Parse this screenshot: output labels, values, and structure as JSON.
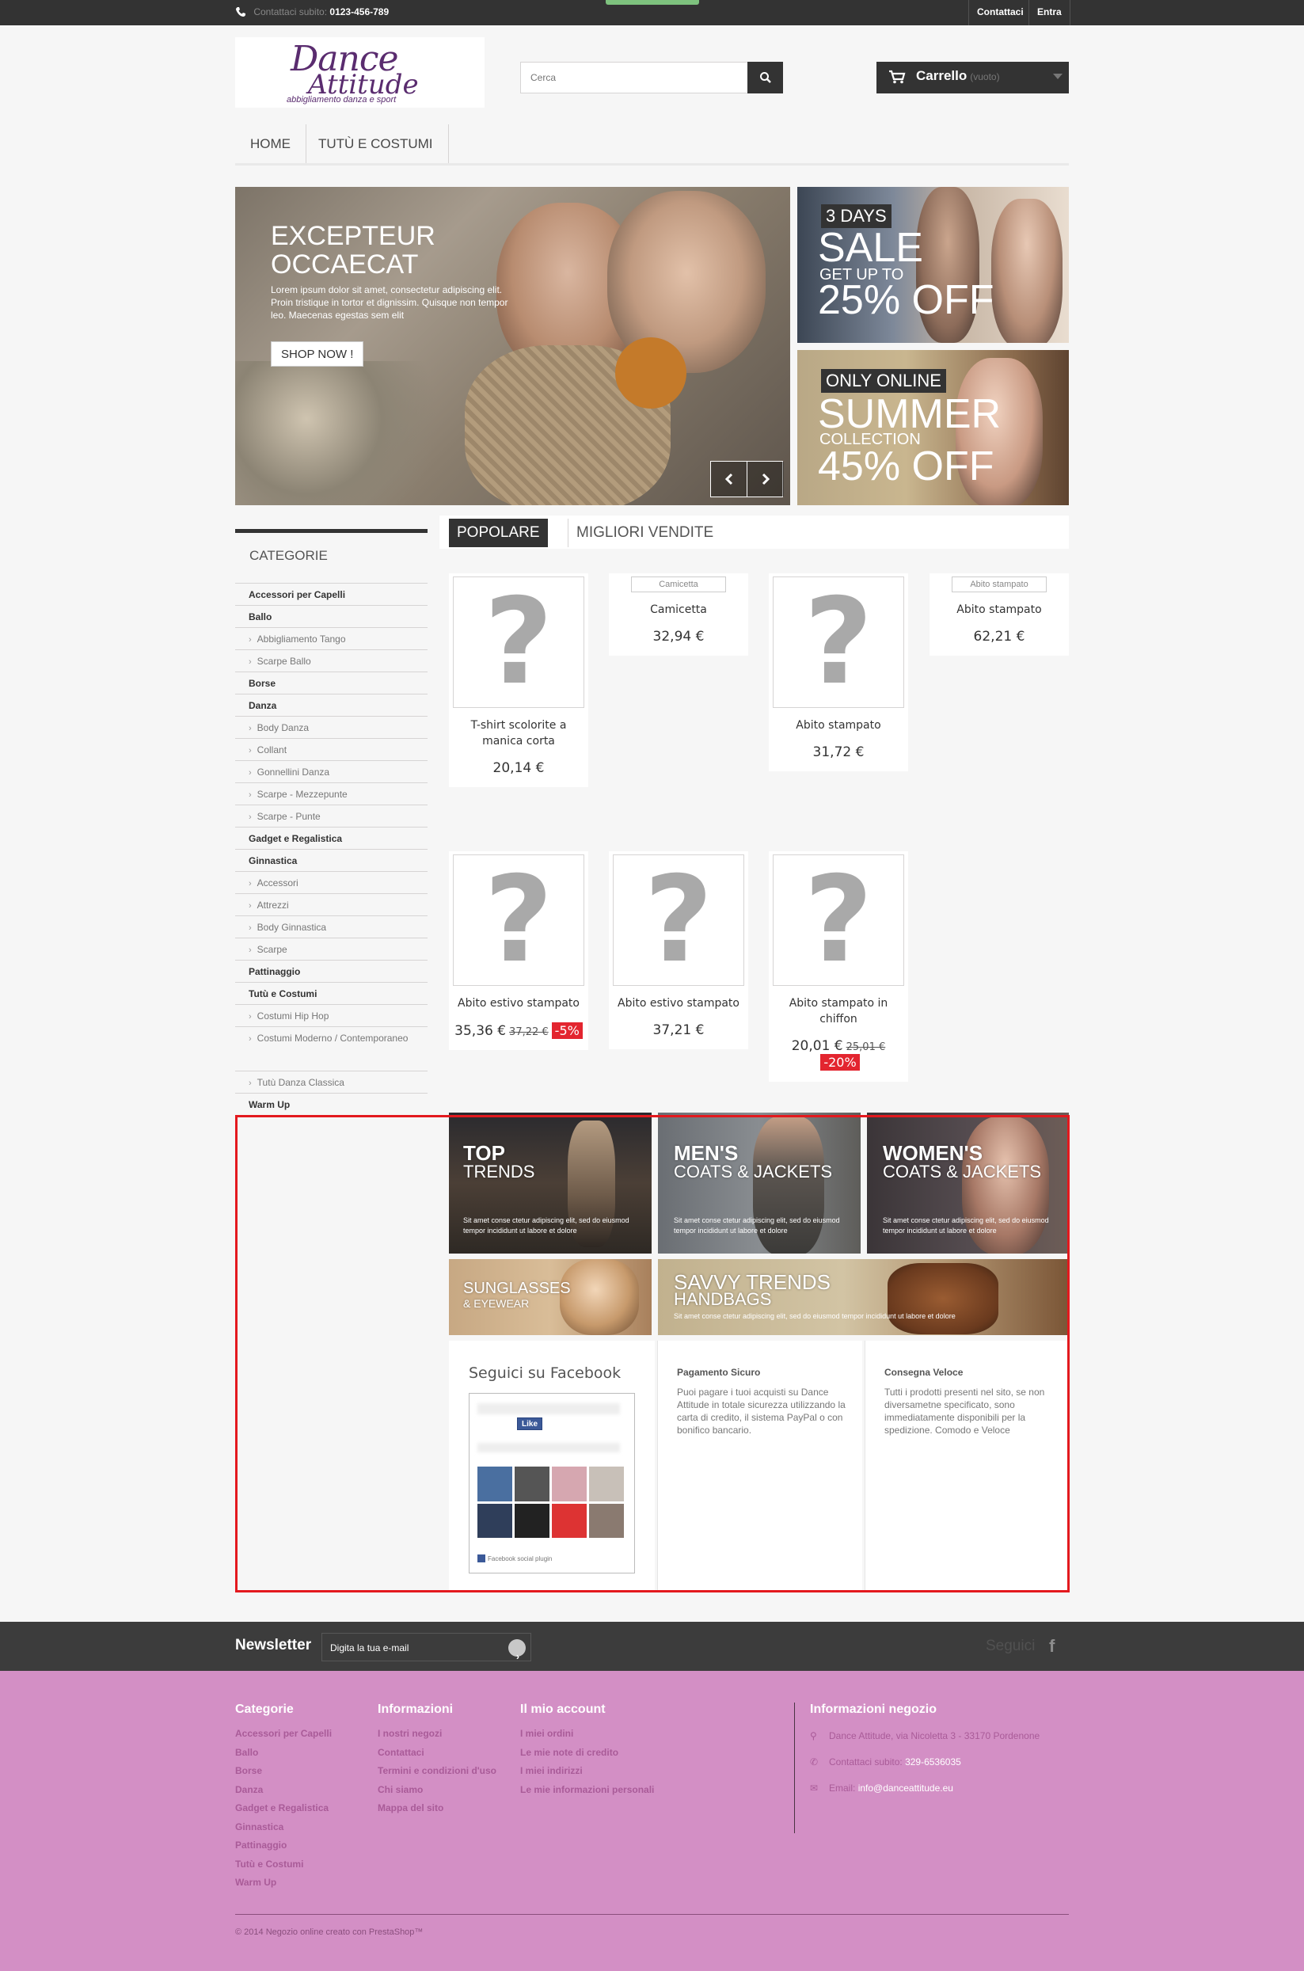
{
  "topbar": {
    "phone_label": "Contattaci subito:",
    "phone_number": "0123-456-789",
    "contact_link": "Contattaci",
    "login_link": "Entra"
  },
  "header": {
    "logo_line1": "Dance",
    "logo_line2": "Attitude",
    "logo_tagline": "abbigliamento danza e sport",
    "search_placeholder": "Cerca",
    "cart_label": "Carrello",
    "cart_status": "(vuoto)"
  },
  "menu": {
    "items": [
      "HOME",
      "TUTÙ E COSTUMI"
    ]
  },
  "slider": {
    "title": "EXCEPTEUR OCCAECAT",
    "text": "Lorem ipsum dolor sit amet, consectetur adipiscing elit. Proin tristique in tortor et dignissim. Quisque non tempor leo. Maecenas egestas sem elit",
    "button": "SHOP NOW !"
  },
  "banners": {
    "sale": {
      "tag": "3 DAYS",
      "big1": "SALE",
      "small": "GET UP TO",
      "big2": "25% OFF"
    },
    "summer": {
      "tag": "ONLY ONLINE",
      "big1": "SUMMER",
      "small": "COLLECTION",
      "big2": "45% OFF"
    }
  },
  "sidebar": {
    "title": "CATEGORIE",
    "categories": [
      {
        "label": "Accessori per Capelli",
        "level": "top"
      },
      {
        "label": "Ballo",
        "level": "top"
      },
      {
        "label": "Abbigliamento Tango",
        "level": "sub"
      },
      {
        "label": "Scarpe Ballo",
        "level": "sub"
      },
      {
        "label": "Borse",
        "level": "top"
      },
      {
        "label": "Danza",
        "level": "top"
      },
      {
        "label": "Body Danza",
        "level": "sub"
      },
      {
        "label": "Collant",
        "level": "sub"
      },
      {
        "label": "Gonnellini Danza",
        "level": "sub"
      },
      {
        "label": "Scarpe - Mezzepunte",
        "level": "sub"
      },
      {
        "label": "Scarpe - Punte",
        "level": "sub"
      },
      {
        "label": "Gadget e Regalistica",
        "level": "top"
      },
      {
        "label": "Ginnastica",
        "level": "top"
      },
      {
        "label": "Accessori",
        "level": "sub"
      },
      {
        "label": "Attrezzi",
        "level": "sub"
      },
      {
        "label": "Body Ginnastica",
        "level": "sub"
      },
      {
        "label": "Scarpe",
        "level": "sub"
      },
      {
        "label": "Pattinaggio",
        "level": "top"
      },
      {
        "label": "Tutù e Costumi",
        "level": "top"
      },
      {
        "label": "Costumi Hip Hop",
        "level": "sub"
      },
      {
        "label": "Costumi Moderno / Contemporaneo",
        "level": "sub"
      },
      {
        "label": "Tutù Danza Classica",
        "level": "sub"
      },
      {
        "label": "Warm Up",
        "level": "top"
      }
    ]
  },
  "tabs": {
    "popular": "POPOLARE",
    "bestsellers": "MIGLIORI VENDITE"
  },
  "products": [
    {
      "name": "T-shirt scolorite a manica corta",
      "price": "20,14 €",
      "image": "placeholder"
    },
    {
      "name": "Camicetta",
      "price": "32,94 €",
      "image": "broken",
      "alt": "Camicetta"
    },
    {
      "name": "Abito stampato",
      "price": "31,72 €",
      "image": "placeholder"
    },
    {
      "name": "Abito stampato",
      "price": "62,21 €",
      "image": "broken",
      "alt": "Abito stampato"
    },
    {
      "name": "Abito estivo stampato",
      "price": "35,36 €",
      "old_price": "37,22 €",
      "discount": "-5%",
      "image": "placeholder"
    },
    {
      "name": "Abito estivo stampato",
      "price": "37,21 €",
      "image": "placeholder"
    },
    {
      "name": "Abito stampato in chiffon",
      "price": "20,01 €",
      "old_price": "25,01 €",
      "discount": "-20%",
      "image": "placeholder"
    }
  ],
  "promos": {
    "top_trends": {
      "line1": "TOP",
      "line2": "TRENDS",
      "text": "Sit amet conse ctetur adipiscing elit, sed do eiusmod tempor incididunt ut labore et dolore"
    },
    "mens": {
      "line1": "MEN'S",
      "line2": "COATS & JACKETS",
      "text": "Sit amet conse ctetur adipiscing elit, sed do eiusmod tempor incididunt ut labore et dolore"
    },
    "womens": {
      "line1": "WOMEN'S",
      "line2": "COATS & JACKETS",
      "text": "Sit amet conse ctetur adipiscing elit, sed do eiusmod tempor incididunt ut labore et dolore"
    },
    "sunglasses": {
      "line1": "SUNGLASSES",
      "line2": "& EYEWEAR"
    },
    "handbags": {
      "line1": "SAVVY TRENDS",
      "line2": "HANDBAGS",
      "text": "Sit amet conse ctetur adipiscing elit, sed do eiusmod tempor incididunt ut labore et dolore"
    }
  },
  "info": {
    "facebook_title": "Seguici su Facebook",
    "facebook_like": "Like",
    "facebook_plugin": "Facebook social plugin",
    "payment_title": "Pagamento Sicuro",
    "payment_text": "Puoi pagare i tuoi acquisti su Dance Attitude in totale sicurezza utilizzando la carta di credito, il sistema PayPal o con bonifico bancario.",
    "delivery_title": "Consegna Veloce",
    "delivery_text": "Tutti i prodotti presenti nel sito, se non diversametne specificato, sono immediatamente disponibili per la spedizione. Comodo e Veloce"
  },
  "newsletter": {
    "label": "Newsletter",
    "placeholder": "Digita la tua e-mail",
    "follow": "Seguici"
  },
  "footer": {
    "categories_title": "Categorie",
    "categories": [
      "Accessori per Capelli",
      "Ballo",
      "Borse",
      "Danza",
      "Gadget e Regalistica",
      "Ginnastica",
      "Pattinaggio",
      "Tutù e Costumi",
      "Warm Up"
    ],
    "info_title": "Informazioni",
    "info_links": [
      "I nostri negozi",
      "Contattaci",
      "Termini e condizioni d'uso",
      "Chi siamo",
      "Mappa del sito"
    ],
    "account_title": "Il mio account",
    "account_links": [
      "I miei ordini",
      "Le mie note di credito",
      "I miei indirizzi",
      "Le mie informazioni personali"
    ],
    "store_title": "Informazioni negozio",
    "store_address": "Dance Attitude, via Nicoletta 3 - 33170 Pordenone",
    "store_phone_label": "Contattaci subito:",
    "store_phone": "329-6536035",
    "store_email_label": "Email:",
    "store_email": "info@danceattitude.eu",
    "copyright": "© 2014 Negozio online creato con PrestaShop™"
  },
  "colors": {
    "accent_dark": "#333333",
    "discount_red": "#e3252f",
    "footer_pink": "#d38fc5",
    "highlight_box": "#e3191e"
  }
}
